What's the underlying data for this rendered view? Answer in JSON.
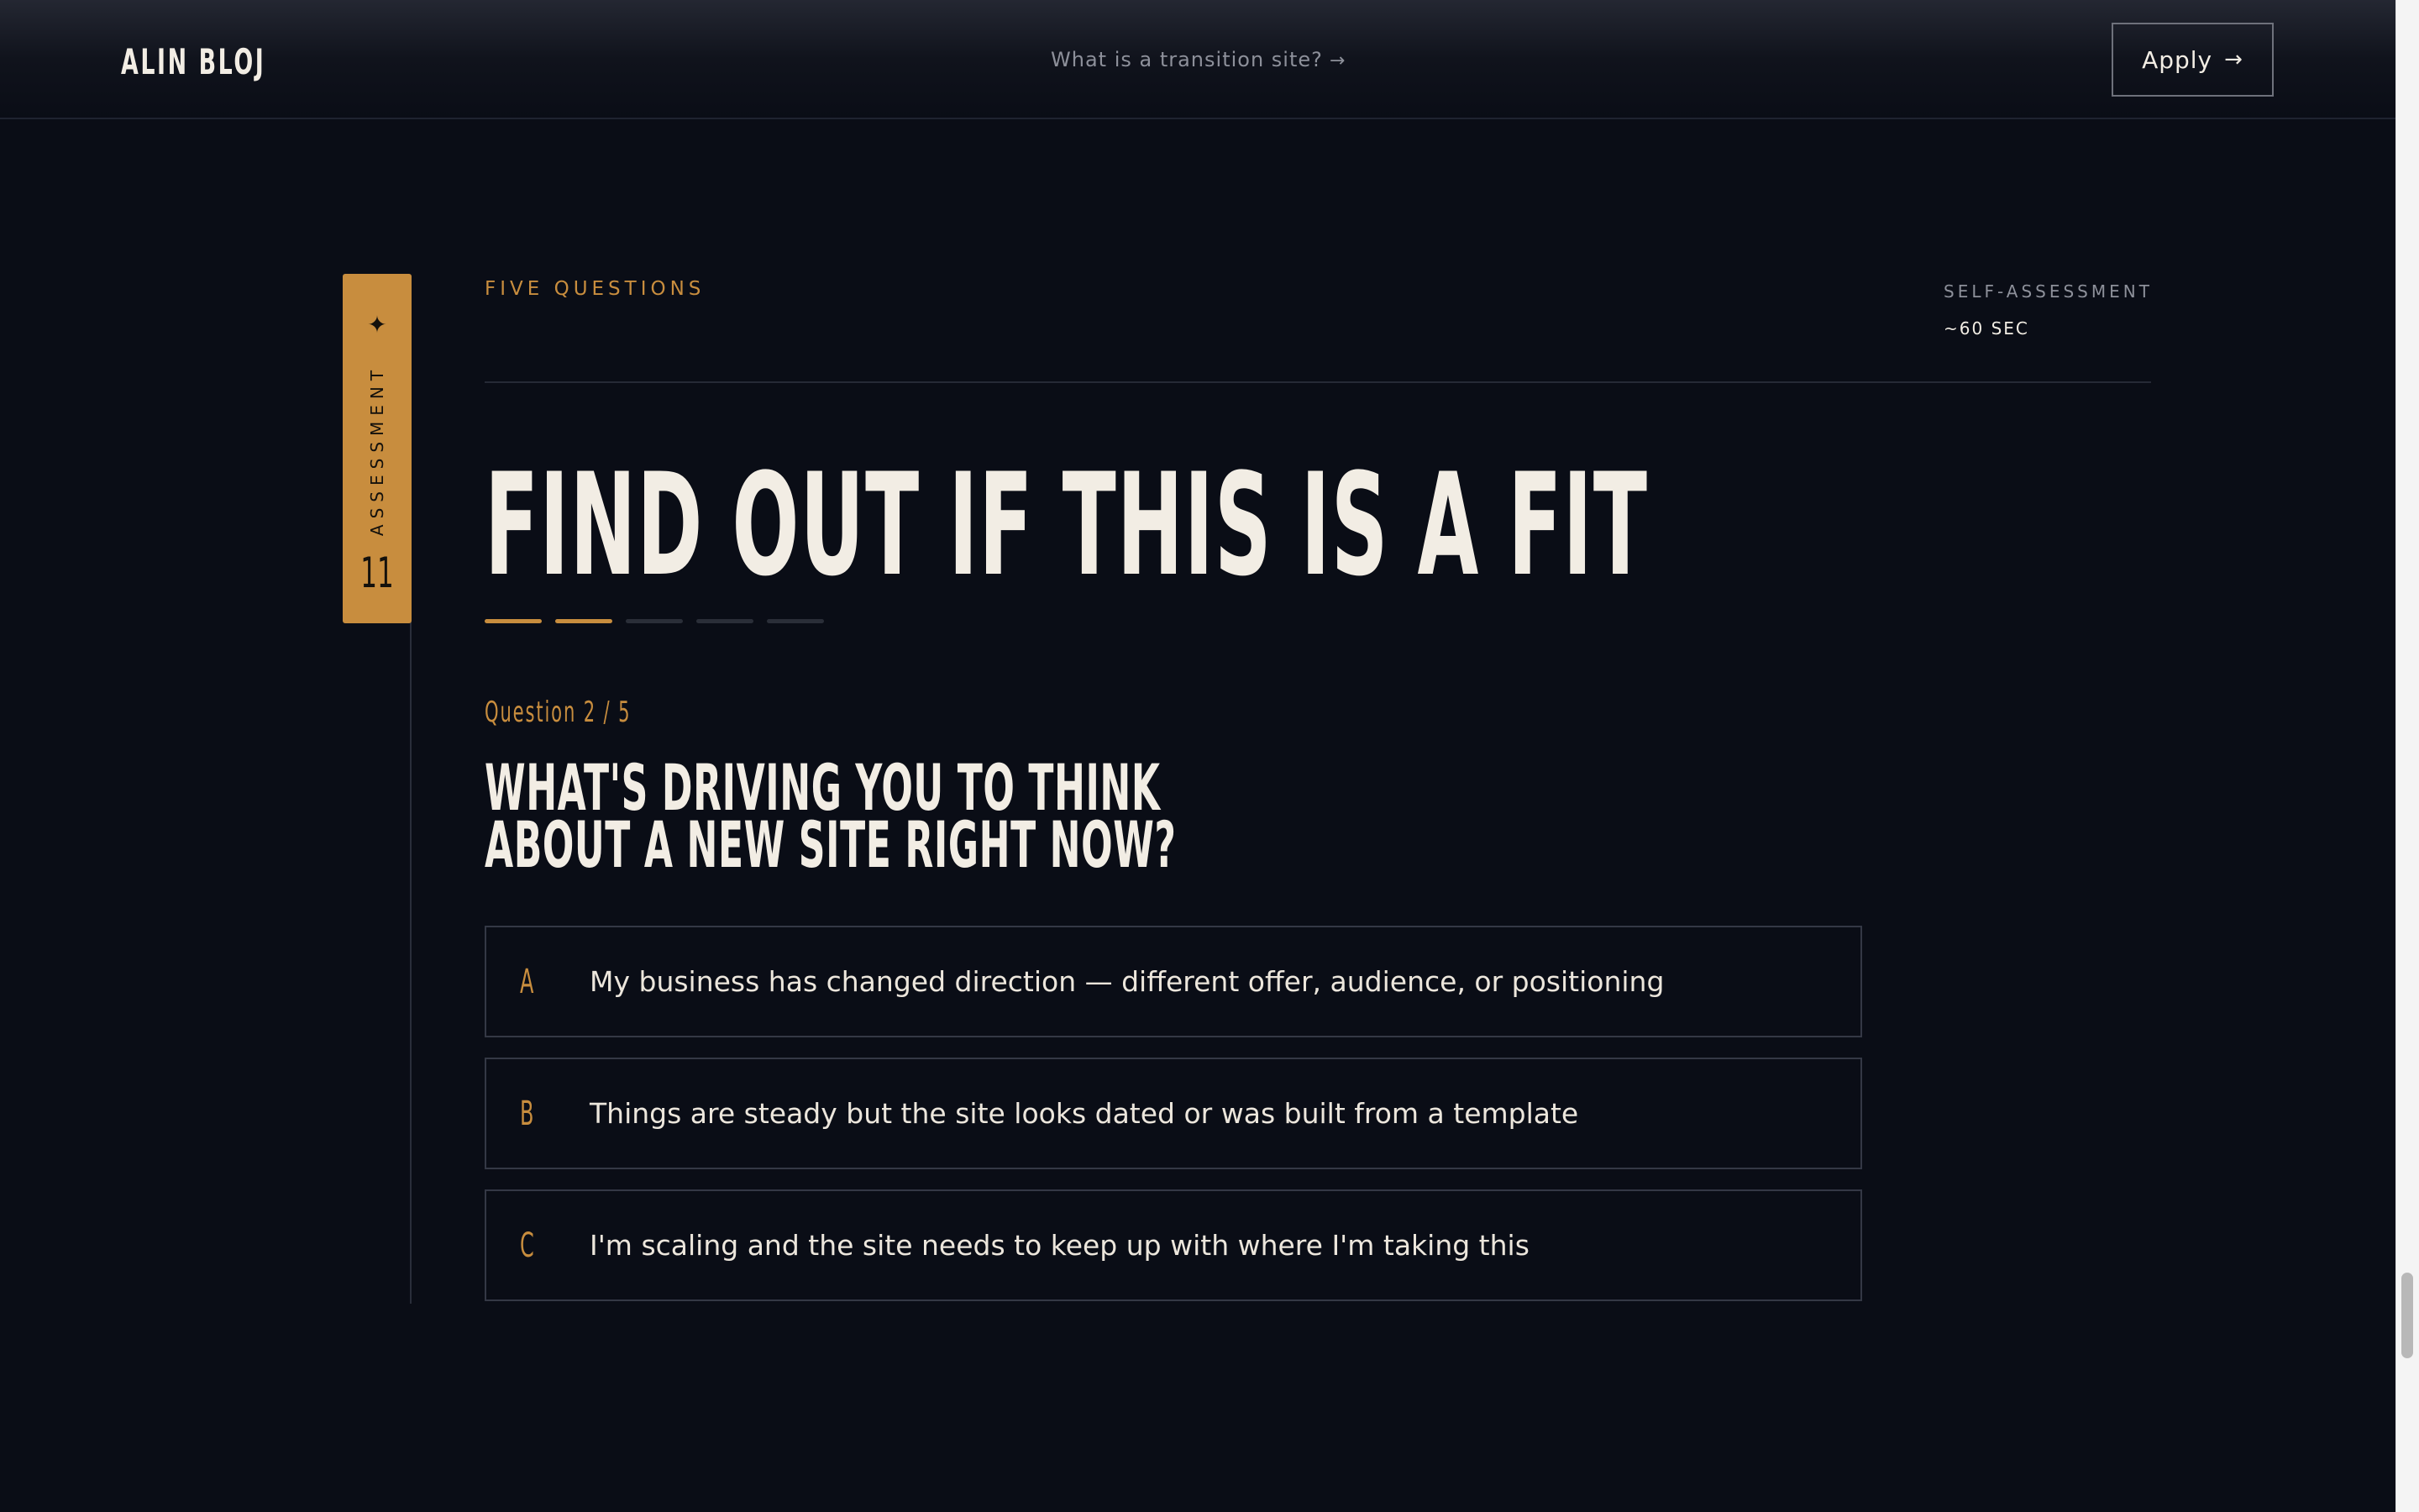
{
  "header": {
    "logo": "ALIN BLOJ",
    "nav_link": "What is a transition site?",
    "nav_link_arrow": "→",
    "apply_label": "Apply",
    "apply_arrow": "→"
  },
  "side_tab": {
    "star": "✦",
    "label": "ASSESSMENT",
    "number": "11"
  },
  "meta": {
    "eyebrow": "FIVE QUESTIONS",
    "kicker": "SELF-ASSESSMENT",
    "duration": "~60 SEC"
  },
  "hero": {
    "title": "FIND OUT IF THIS IS A FIT"
  },
  "progress": {
    "current": 2,
    "total": 5
  },
  "question": {
    "counter": "Question 2 / 5",
    "line1": "WHAT'S DRIVING YOU TO THINK",
    "line2": "ABOUT A NEW SITE RIGHT NOW?",
    "options": [
      {
        "letter": "A",
        "text": "My business has changed direction — different offer, audience, or positioning"
      },
      {
        "letter": "B",
        "text": "Things are steady but the site looks dated or was built from a template"
      },
      {
        "letter": "C",
        "text": "I'm scaling and the site needs to keep up with where I'm taking this"
      }
    ]
  },
  "colors": {
    "background": "#0a0d16",
    "accent": "#c88d3e",
    "text": "#f2ede4",
    "muted": "#8d909a",
    "border": "#343845"
  }
}
